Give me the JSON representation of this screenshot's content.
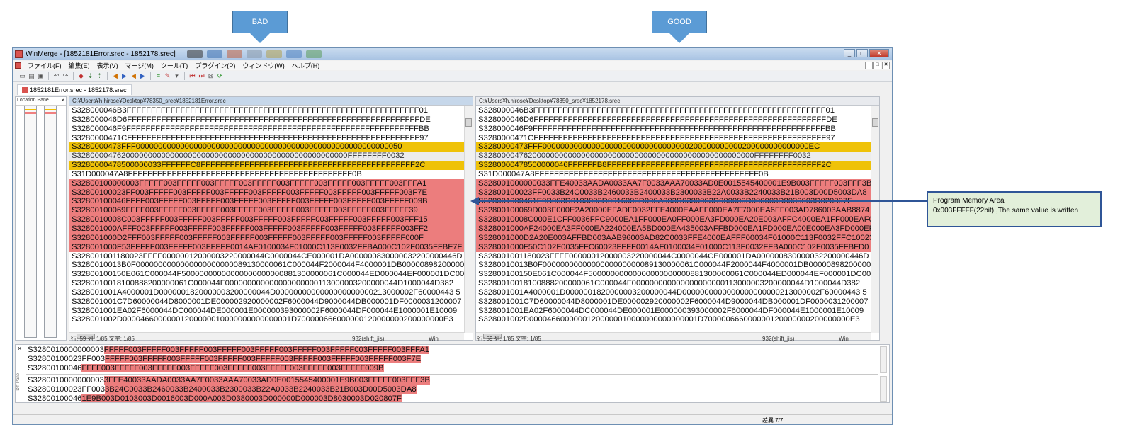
{
  "callouts": {
    "bad": "BAD",
    "good": "GOOD"
  },
  "window": {
    "title": "WinMerge - [1852181Error.srec - 1852178.srec]",
    "menu": [
      "ファイル(F)",
      "編集(E)",
      "表示(V)",
      "マージ(M)",
      "ツール(T)",
      "プラグイン(P)",
      "ウィンドウ(W)",
      "ヘルプ(H)"
    ],
    "doc_tab": "1852181Error.srec - 1852178.srec"
  },
  "location_pane": {
    "title": "Location Pane",
    "close": "×"
  },
  "left_pane": {
    "path": "C:¥Users¥h.hirose¥Desktop¥78350_srec¥1852181Error.srec",
    "lines": [
      {
        "text": "S328000046B3FFFFFFFFFFFFFFFFFFFFFFFFFFFFFFFFFFFFFFFFFFFFFFFFFFFFFFFFFFFF01",
        "hl": "b"
      },
      {
        "text": "S328000046D6FFFFFFFFFFFFFFFFFFFFFFFFFFFFFFFFFFFFFFFFFFFFFFFFFFFFFFFFFFFFDE",
        "hl": "b"
      },
      {
        "text": "S328000046F9FFFFFFFFFFFFFFFFFFFFFFFFFFFFFFFFFFFFFFFFFFFFFFFFFFFFFFFFFFFFBB",
        "hl": "b"
      },
      {
        "text": "S3280000471CFFFFFFFFFFFFFFFFFFFFFFFFFFFFFFFFFFFFFFFFFFFFFFFFFFFFFFFFFFFF97",
        "hl": "b"
      },
      {
        "text": "S3280000473FFF000000000000000000000000000000000000000000000000000000000050",
        "hl": "y"
      },
      {
        "text": "S3280000476200000000000000000000000000000000000000000000000000FFFFFFFF0032",
        "hl": "g"
      },
      {
        "text": "S3280000478500000033FFFFFFC8FFFFFFFFFFFFFFFFFFFFFFFFFFFFFFFFFFFFFFFFFFFF2C",
        "hl": "y"
      },
      {
        "text": "S31D000047A8FFFFFFFFFFFFFFFFFFFFFFFFFFFFFFFFFFFFFFFFFFFFFF0B",
        "hl": "b"
      },
      {
        "text": "S32800100000003FFFFF003FFFFF003FFFFF003FFFFF003FFFFF003FFFFF003FFFFF003FFFA1",
        "hl": "r"
      },
      {
        "text": "S32800100023FF003FFFFF003FFFFF003FFFFF003FFFFF003FFFFF003FFFFF003FFFFF003F7E",
        "hl": "r"
      },
      {
        "text": "S32800100046FFFF003FFFFF003FFFFF003FFFFF003FFFFF003FFFFF003FFFFF003FFFFF009B",
        "hl": "r"
      },
      {
        "text": "S32800100069FFFF003FFFFF003FFFFF003FFFFF003FFFFF003FFFFF003FFFFF003FFFFF39",
        "hl": "r"
      },
      {
        "text": "S3280010008C003FFFFF003FFFFF003FFFFF003FFFFF003FFFFF003FFFFF003FFFFF003FFF15",
        "hl": "r"
      },
      {
        "text": "S328001000AFFF003FFFFF003FFFFF003FFFFF003FFFFF003FFFFF003FFFFF003FFFFF003FF2",
        "hl": "r"
      },
      {
        "text": "S328001000D2FFF003FFFFF003FFFFF003FFFFF003FFFFF003FFFFF003FFFFF003FFFFF000F",
        "hl": "r"
      },
      {
        "text": "S328001000F53FFFFF003FFFFF003FFFFF0014AF0100034F01000C113F0032FFBA000C102F0035FFBF7F",
        "hl": "r"
      },
      {
        "text": "S328001001180023FFFF00000012000003220000044C0000044CE000001DA000000830000032200000446D",
        "hl": "b"
      },
      {
        "text": "S3280010013B0F0000000000000000000000089130000061C000044F2000044F4000001DB00000898200000A9",
        "hl": "b"
      },
      {
        "text": "S32800100150E061C000044F50000000000000000000000881300000061C000044ED000044EF000001DC000F",
        "hl": "b"
      },
      {
        "text": "S3280010018100888200000061C000044F000000000000000000000113000003200000044D1000044D382",
        "hl": "b"
      },
      {
        "text": "S328001001A4000001D0000001820000003200000044D0000000000000000000000213000002F60000443 5",
        "hl": "b"
      },
      {
        "text": "S328001001C7D60000044D8000001DE000002920000002F6000044D9000044DB000001DF0000031200007 1",
        "hl": "b"
      },
      {
        "text": "S328001001EA02F6000044DC000044DE000001E000000393000002F6000044DF000044E1000001E10009",
        "hl": "b"
      },
      {
        "text": "S328001002D00004660000001200000010000000000000001D700000666000000120000000200000000E3",
        "hl": "b"
      }
    ],
    "status": {
      "pos": "行: 59  列: 1/85  文字: 1/85",
      "encoding": "932(shift_jis)",
      "eol": "Win"
    }
  },
  "right_pane": {
    "path": "C:¥Users¥h.hirose¥Desktop¥78350_srec¥1852178.srec",
    "lines": [
      {
        "text": "S328000046B3FFFFFFFFFFFFFFFFFFFFFFFFFFFFFFFFFFFFFFFFFFFFFFFFFFFFFFFFFFFF01",
        "hl": "b"
      },
      {
        "text": "S328000046D6FFFFFFFFFFFFFFFFFFFFFFFFFFFFFFFFFFFFFFFFFFFFFFFFFFFFFFFFFFFFDE",
        "hl": "b"
      },
      {
        "text": "S328000046F9FFFFFFFFFFFFFFFFFFFFFFFFFFFFFFFFFFFFFFFFFFFFFFFFFFFFFFFFFFFFBB",
        "hl": "b"
      },
      {
        "text": "S3280000471CFFFFFFFFFFFFFFFFFFFFFFFFFFFFFFFFFFFFFFFFFFFFFFFFFFFFFFFFFFFF97",
        "hl": "b"
      },
      {
        "text": "S3280000473FFF000000000000000000000000000000000200000000000200000000000000EC",
        "hl": "y"
      },
      {
        "text": "S3280000476200000000000000000000000000000000000000000000000000FFFFFFFF0032",
        "hl": "g"
      },
      {
        "text": "S3280000478500000046FFFFFFB8FFFFFFFFFFFFFFFFFFFFFFFFFFFFFFFFFFFFFFFFFFFF2C",
        "hl": "y"
      },
      {
        "text": "S31D000047A8FFFFFFFFFFFFFFFFFFFFFFFFFFFFFFFFFFFFFFFFFFFFFF0B",
        "hl": "b"
      },
      {
        "text": "S328001000000033FFE40033AADA0033AA7F0033AAA70033AD0E0015545400001E9B003FFFFF003FFF3B",
        "hl": "r"
      },
      {
        "text": "S32800100023FF0033B24C0033B2460033B2400033B2300033B22A0033B2240033B21B003D00D5003DA8",
        "hl": "r"
      },
      {
        "text": "S328001000461E9B003D0103003D0016003D000A003D0380003D000000D000003D8030003D020807F",
        "hl": "r"
      },
      {
        "text": "S32800100069D003F000E2A20000EFADF0032FFE4000EAAFF000EA7F7000EA6FF003AD786003AAB8874",
        "hl": "r"
      },
      {
        "text": "S3280010008C000E1CFF0036FFC9000EA1FF000EA0FF000EA3FD000EA20E003AFFC4000EA1FF000EAF04",
        "hl": "r"
      },
      {
        "text": "S328001000AF24000EA3FF000EA224000EA5BD000EA435003AFFBD000EA1FD000EA00E000EA3FD000EFF",
        "hl": "r"
      },
      {
        "text": "S328001000D2A20E003AFFBD003AAB96003AD82C0033FFE4000EAFFF00034F01000C113F0032FFC10023",
        "hl": "r"
      },
      {
        "text": "S328001000F50C102F0035FFC60023FFFF0014AF0100034F01000C113F0032FFBA000C102F0035FFBFD0",
        "hl": "r"
      },
      {
        "text": "S328001001180023FFFF00000012000003220000044C0000044CE000001DA000000830000032200000446D",
        "hl": "b"
      },
      {
        "text": "S3280010013B0F0000000000000000000000089130000061C000044F2000044F4000001DB00000898200000A9",
        "hl": "b"
      },
      {
        "text": "S32800100150E061C000044F50000000000000000000000881300000061C000044ED000044EF000001DC000F",
        "hl": "b"
      },
      {
        "text": "S3280010018100888200000061C000044F000000000000000000000113000003200000044D1000044D382",
        "hl": "b"
      },
      {
        "text": "S328001001A4000001D0000001820000003200000044D0000000000000000000000213000002F60000443 5",
        "hl": "b"
      },
      {
        "text": "S328001001C7D60000044D8000001DE000002920000002F6000044D9000044DB000001DF0000031200007 1",
        "hl": "b"
      },
      {
        "text": "S328001001EA02F6000044DC000044DE000001E000000393000002F6000044DF000044E1000001E10009",
        "hl": "b"
      },
      {
        "text": "S328001002D00004660000001200000010000000000000001D700000666000000120000000200000000E3",
        "hl": "b"
      }
    ],
    "status": {
      "pos": "行: 59  列: 1/85  文字: 1/85",
      "encoding": "932(shift_jis)",
      "eol": "Win"
    }
  },
  "diff_pane": {
    "label": "Diff Pane",
    "close": "×",
    "top": [
      {
        "pre": "S3280010000000003",
        "hl": "FFFFF003FFFFF003FFFFF003FFFFF003FFFFF003FFFFF003FFFFF003FFFFF003FFFA1"
      },
      {
        "pre": "S32800100023FF003",
        "hl": "FFFFF003FFFFF003FFFFF003FFFFF003FFFFF003FFFFF003FFFFF003FFFFF003F7E"
      },
      {
        "pre": "S32800100046",
        "hl": "FFFF003FFFFF003FFFFF003FFFFF003FFFFF003FFFFF003FFFFF003FFFFF009B"
      }
    ],
    "bottom": [
      {
        "pre": "S3280010000000003",
        "hl": "3FFE40033AADA0033AA7F0033AAA70033AD0E0015545400001E9B003FFFFF003FFF3B"
      },
      {
        "pre": "S32800100023FF003",
        "hl": "3B24C0033B2460033B2400033B2300033B22A0033B2240033B21B003D00D5003DA8"
      },
      {
        "pre": "S32800100046",
        "hl": "1E9B003D0103003D0016003D000A003D0380003D000000D000003D8030003D020807F"
      }
    ]
  },
  "statusbar": {
    "text": "差異 7/7"
  },
  "annotation": {
    "line1": "Program Memory Area",
    "line2": "0x003FFFFF(22bit) ,The same value is written"
  },
  "colors": {
    "added_yellow": "#efc208",
    "changed_red": "#ec7d7d",
    "annotation_border": "#2f5597",
    "callout_fill": "#5b9bd5"
  }
}
